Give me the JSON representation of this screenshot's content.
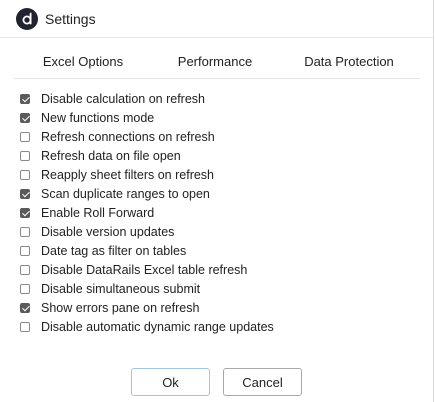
{
  "window": {
    "title": "Settings",
    "logo_icon": "datarails-logo-icon"
  },
  "tabs": [
    {
      "label": "Excel Options",
      "active": true
    },
    {
      "label": "Performance",
      "active": false
    },
    {
      "label": "Data Protection",
      "active": false
    }
  ],
  "options": [
    {
      "label": "Disable calculation on refresh",
      "checked": true
    },
    {
      "label": "New functions mode",
      "checked": true
    },
    {
      "label": "Refresh connections on refresh",
      "checked": false
    },
    {
      "label": "Refresh data on file open",
      "checked": false
    },
    {
      "label": "Reapply sheet filters on refresh",
      "checked": false
    },
    {
      "label": "Scan duplicate ranges to open",
      "checked": true
    },
    {
      "label": "Enable Roll Forward",
      "checked": true
    },
    {
      "label": "Disable version updates",
      "checked": false
    },
    {
      "label": "Date tag as filter on tables",
      "checked": false
    },
    {
      "label": "Disable DataRails Excel table refresh",
      "checked": false
    },
    {
      "label": "Disable simultaneous submit",
      "checked": false
    },
    {
      "label": "Show errors pane on refresh",
      "checked": true
    },
    {
      "label": "Disable automatic dynamic range updates",
      "checked": false
    }
  ],
  "buttons": {
    "ok_label": "Ok",
    "cancel_label": "Cancel"
  },
  "colors": {
    "active_tab_underline": "#2aa37a",
    "checkbox_checked": "#5a5a5a",
    "ok_border": "#9fc4e6"
  }
}
